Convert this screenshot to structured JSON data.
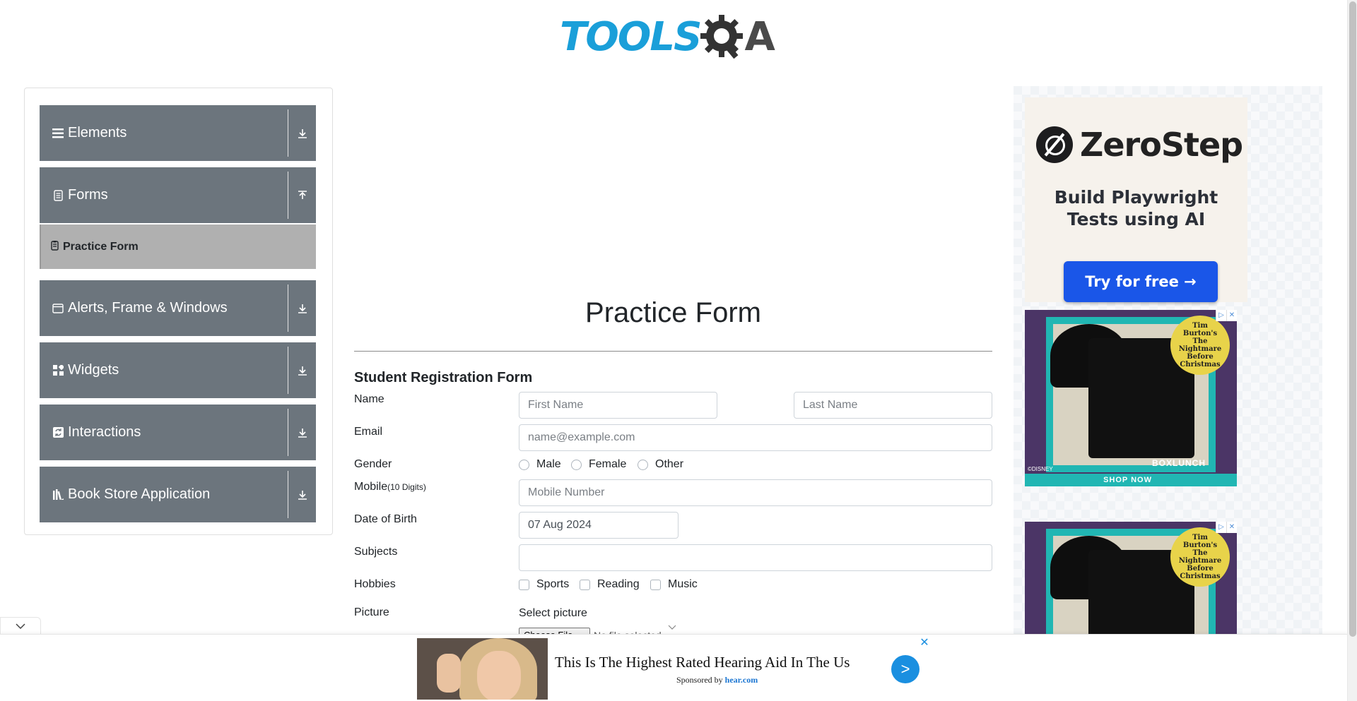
{
  "header": {
    "logo_text": "TOOLS",
    "logo_suffix": "A",
    "logo_colors": {
      "tools": "#1a9fd9",
      "qa": "#4a4a4a"
    }
  },
  "sidebar": {
    "groups": [
      {
        "label": "Elements",
        "icon": "hamburger-icon",
        "arrow": "down"
      },
      {
        "label": "Forms",
        "icon": "document-icon",
        "arrow": "up"
      },
      {
        "label": "Alerts, Frame & Windows",
        "icon": "window-icon",
        "arrow": "down"
      },
      {
        "label": "Widgets",
        "icon": "grid-icon",
        "arrow": "down"
      },
      {
        "label": "Interactions",
        "icon": "refresh-icon",
        "arrow": "down"
      },
      {
        "label": "Book Store Application",
        "icon": "books-icon",
        "arrow": "down"
      }
    ],
    "active_item": {
      "label": "Practice Form",
      "icon": "form-icon"
    }
  },
  "main": {
    "title": "Practice Form",
    "form_heading": "Student Registration Form",
    "labels": {
      "name": "Name",
      "email": "Email",
      "gender": "Gender",
      "mobile": "Mobile",
      "mobile_hint": "(10 Digits)",
      "dob": "Date of Birth",
      "subjects": "Subjects",
      "hobbies": "Hobbies",
      "picture": "Picture"
    },
    "fields": {
      "first_name_placeholder": "First Name",
      "last_name_placeholder": "Last Name",
      "email_placeholder": "name@example.com",
      "mobile_placeholder": "Mobile Number",
      "dob_value": "07 Aug 2024",
      "subjects_value": ""
    },
    "gender_options": [
      "Male",
      "Female",
      "Other"
    ],
    "hobby_options": [
      "Sports",
      "Reading",
      "Music"
    ],
    "select_picture_label": "Select picture",
    "file_button_label": "Choose File",
    "file_status": "No file selected."
  },
  "ads": {
    "zerostep": {
      "brand": "ZeroStep",
      "tagline_line1": "Build Playwright",
      "tagline_line2": "Tests using AI",
      "cta": "Try for free →",
      "cta_color": "#1a56e8"
    },
    "boxlunch": {
      "badge": "Tim Burton's The Nightmare Before Christmas",
      "brand": "BOXLUNCH",
      "cta": "SHOP NOW",
      "disney": "©DISNEY",
      "accent": "#21b6b3"
    },
    "bottom": {
      "title": "This Is The Highest Rated Hearing Aid In The Us",
      "sponsored_prefix": "Sponsored by",
      "sponsor": "hear.com",
      "button_symbol": ">",
      "close_symbol": "✕"
    }
  },
  "colors": {
    "sidebar_group_bg": "#6c757d",
    "sidebar_active_bg": "#b0b0b0",
    "input_border": "#ced4da"
  }
}
